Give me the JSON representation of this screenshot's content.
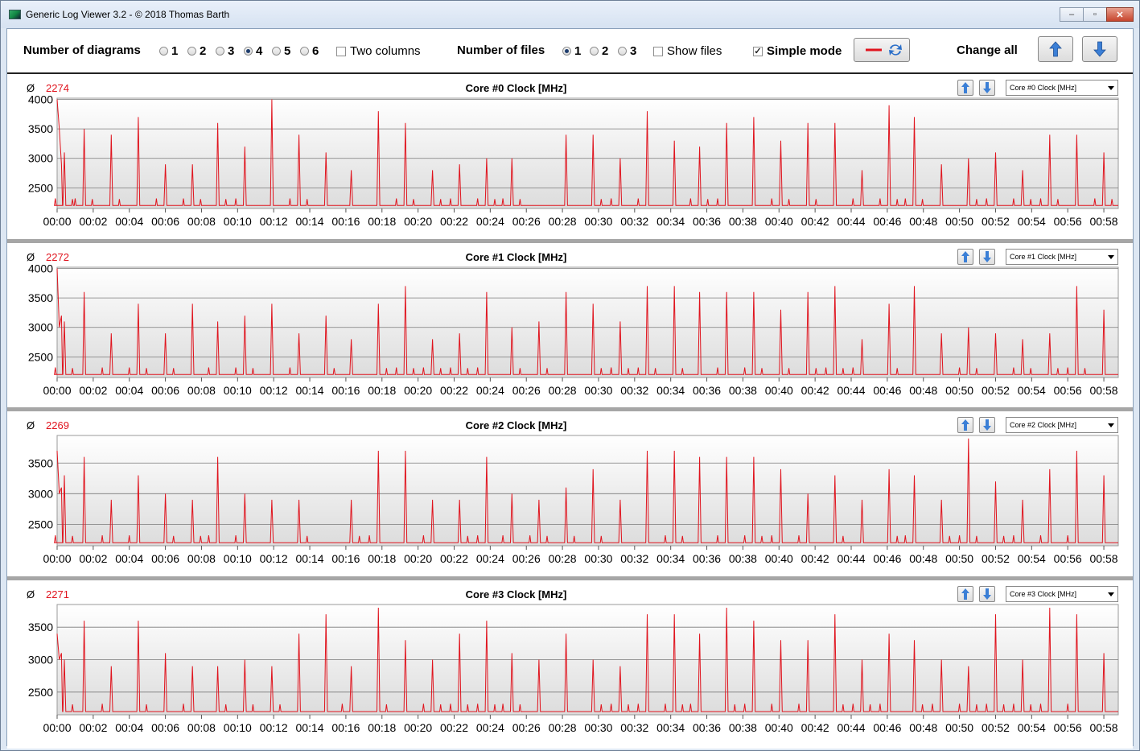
{
  "window": {
    "title": "Generic Log Viewer 3.2 - © 2018 Thomas Barth",
    "minimize": "–",
    "maximize": "▫",
    "close": "✕"
  },
  "toolbar": {
    "diagrams_label": "Number of diagrams",
    "diagram_options": [
      "1",
      "2",
      "3",
      "4",
      "5",
      "6"
    ],
    "diagram_selected": "4",
    "two_columns_label": "Two columns",
    "two_columns_checked": false,
    "files_label": "Number of files",
    "file_options": [
      "1",
      "2",
      "3"
    ],
    "file_selected": "1",
    "show_files_label": "Show files",
    "show_files_checked": false,
    "simple_mode_label": "Simple mode",
    "simple_mode_checked": true,
    "change_all_label": "Change all",
    "line_color": "#e0141e",
    "refresh_color": "#2a6fc9",
    "arrow_color": "#3b7fd6"
  },
  "x_ticks": [
    "00:00",
    "00:02",
    "00:04",
    "00:06",
    "00:08",
    "00:10",
    "00:12",
    "00:14",
    "00:16",
    "00:18",
    "00:20",
    "00:22",
    "00:24",
    "00:26",
    "00:28",
    "00:30",
    "00:32",
    "00:34",
    "00:36",
    "00:38",
    "00:40",
    "00:42",
    "00:44",
    "00:46",
    "00:48",
    "00:50",
    "00:52",
    "00:54",
    "00:56",
    "00:58"
  ],
  "panels": [
    {
      "avg_symbol": "Ø",
      "avg": "2274",
      "title": "Core #0 Clock [MHz]",
      "select": "Core #0 Clock [MHz]"
    },
    {
      "avg_symbol": "Ø",
      "avg": "2272",
      "title": "Core #1 Clock [MHz]",
      "select": "Core #1 Clock [MHz]"
    },
    {
      "avg_symbol": "Ø",
      "avg": "2269",
      "title": "Core #2 Clock [MHz]",
      "select": "Core #2 Clock [MHz]"
    },
    {
      "avg_symbol": "Ø",
      "avg": "2271",
      "title": "Core #3 Clock [MHz]",
      "select": "Core #3 Clock [MHz]"
    }
  ],
  "chart_data": [
    {
      "type": "line",
      "title": "Core #0 Clock [MHz]",
      "xlabel": "",
      "ylabel": "",
      "yticks": [
        2500,
        3000,
        3500,
        4000
      ],
      "ylim": [
        2150,
        4020
      ],
      "xlim_minutes": [
        0,
        58.8
      ],
      "baseline": 2200,
      "series": [
        {
          "values_note_free": true,
          "color": "#e0141e",
          "start": [
            4000,
            3500,
            2900
          ],
          "spikes": [
            [
              0.4,
              3100
            ],
            [
              1.5,
              3500
            ],
            [
              3.0,
              3400
            ],
            [
              4.5,
              3700
            ],
            [
              6.0,
              2900
            ],
            [
              7.5,
              2900
            ],
            [
              8.9,
              3600
            ],
            [
              10.4,
              3200
            ],
            [
              11.9,
              4000
            ],
            [
              13.4,
              3400
            ],
            [
              14.9,
              3100
            ],
            [
              16.3,
              2800
            ],
            [
              17.8,
              3800
            ],
            [
              19.3,
              3600
            ],
            [
              20.8,
              2800
            ],
            [
              22.3,
              2900
            ],
            [
              23.8,
              3000
            ],
            [
              25.2,
              3000
            ],
            [
              28.2,
              3400
            ],
            [
              29.7,
              3400
            ],
            [
              31.2,
              3000
            ],
            [
              32.7,
              3800
            ],
            [
              34.2,
              3300
            ],
            [
              35.6,
              3200
            ],
            [
              37.1,
              3600
            ],
            [
              38.6,
              3700
            ],
            [
              40.1,
              3300
            ],
            [
              41.6,
              3600
            ],
            [
              43.1,
              3600
            ],
            [
              44.6,
              2800
            ],
            [
              46.1,
              3900
            ],
            [
              47.5,
              3700
            ],
            [
              49.0,
              2900
            ],
            [
              50.5,
              3000
            ],
            [
              52.0,
              3100
            ],
            [
              53.5,
              2800
            ],
            [
              55.0,
              3400
            ],
            [
              56.5,
              3400
            ],
            [
              58.0,
              3100
            ]
          ]
        }
      ]
    },
    {
      "type": "line",
      "title": "Core #1 Clock [MHz]",
      "xlabel": "",
      "ylabel": "",
      "yticks": [
        2500,
        3000,
        3500,
        4000
      ],
      "ylim": [
        2150,
        4020
      ],
      "xlim_minutes": [
        0,
        58.8
      ],
      "baseline": 2200,
      "series": [
        {
          "color": "#e0141e",
          "start": [
            4000,
            3000,
            3200
          ],
          "spikes": [
            [
              0.4,
              3100
            ],
            [
              1.5,
              3600
            ],
            [
              3.0,
              2900
            ],
            [
              4.5,
              3400
            ],
            [
              6.0,
              2900
            ],
            [
              7.5,
              3400
            ],
            [
              8.9,
              3100
            ],
            [
              10.4,
              3200
            ],
            [
              11.9,
              3400
            ],
            [
              13.4,
              2900
            ],
            [
              14.9,
              3200
            ],
            [
              16.3,
              2800
            ],
            [
              17.8,
              3400
            ],
            [
              19.3,
              3700
            ],
            [
              20.8,
              2800
            ],
            [
              22.3,
              2900
            ],
            [
              23.8,
              3600
            ],
            [
              25.2,
              3000
            ],
            [
              26.7,
              3100
            ],
            [
              28.2,
              3600
            ],
            [
              29.7,
              3400
            ],
            [
              31.2,
              3100
            ],
            [
              32.7,
              3700
            ],
            [
              34.2,
              3700
            ],
            [
              35.6,
              3600
            ],
            [
              37.1,
              3600
            ],
            [
              38.6,
              3600
            ],
            [
              40.1,
              3300
            ],
            [
              41.6,
              3600
            ],
            [
              43.1,
              3700
            ],
            [
              44.6,
              2800
            ],
            [
              46.1,
              3400
            ],
            [
              47.5,
              3700
            ],
            [
              49.0,
              2900
            ],
            [
              50.5,
              3000
            ],
            [
              52.0,
              2900
            ],
            [
              53.5,
              2800
            ],
            [
              55.0,
              2900
            ],
            [
              56.5,
              3700
            ],
            [
              58.0,
              3300
            ]
          ]
        }
      ]
    },
    {
      "type": "line",
      "title": "Core #2 Clock [MHz]",
      "xlabel": "",
      "ylabel": "",
      "yticks": [
        2500,
        3000,
        3500
      ],
      "ylim": [
        2150,
        3950
      ],
      "xlim_minutes": [
        0,
        58.8
      ],
      "baseline": 2200,
      "series": [
        {
          "color": "#e0141e",
          "start": [
            3700,
            3000,
            3100
          ],
          "spikes": [
            [
              0.4,
              3300
            ],
            [
              1.5,
              3600
            ],
            [
              3.0,
              2900
            ],
            [
              4.5,
              3300
            ],
            [
              6.0,
              3000
            ],
            [
              7.5,
              2900
            ],
            [
              8.9,
              3600
            ],
            [
              10.4,
              3000
            ],
            [
              11.9,
              2900
            ],
            [
              13.4,
              2900
            ],
            [
              16.3,
              2900
            ],
            [
              17.8,
              3700
            ],
            [
              19.3,
              3700
            ],
            [
              20.8,
              2900
            ],
            [
              22.3,
              2900
            ],
            [
              23.8,
              3600
            ],
            [
              25.2,
              3000
            ],
            [
              26.7,
              2900
            ],
            [
              28.2,
              3100
            ],
            [
              29.7,
              3400
            ],
            [
              31.2,
              2900
            ],
            [
              32.7,
              3700
            ],
            [
              34.2,
              3700
            ],
            [
              35.6,
              3600
            ],
            [
              37.1,
              3600
            ],
            [
              38.6,
              3600
            ],
            [
              40.1,
              3400
            ],
            [
              41.6,
              3000
            ],
            [
              43.1,
              3300
            ],
            [
              44.6,
              2900
            ],
            [
              46.1,
              3400
            ],
            [
              47.5,
              3300
            ],
            [
              49.0,
              2900
            ],
            [
              50.5,
              3900
            ],
            [
              52.0,
              3200
            ],
            [
              53.5,
              2900
            ],
            [
              55.0,
              3400
            ],
            [
              56.5,
              3700
            ],
            [
              58.0,
              3300
            ]
          ]
        }
      ]
    },
    {
      "type": "line",
      "title": "Core #3 Clock [MHz]",
      "xlabel": "",
      "ylabel": "",
      "yticks": [
        2500,
        3000,
        3500
      ],
      "ylim": [
        2150,
        3850
      ],
      "xlim_minutes": [
        0,
        58.8
      ],
      "baseline": 2200,
      "series": [
        {
          "color": "#e0141e",
          "start": [
            3400,
            3000,
            3100
          ],
          "spikes": [
            [
              0.4,
              3000
            ],
            [
              1.5,
              3600
            ],
            [
              3.0,
              2900
            ],
            [
              4.5,
              3600
            ],
            [
              6.0,
              3100
            ],
            [
              7.5,
              2900
            ],
            [
              8.9,
              2900
            ],
            [
              10.4,
              3000
            ],
            [
              11.9,
              2900
            ],
            [
              13.4,
              3400
            ],
            [
              14.9,
              3700
            ],
            [
              16.3,
              2900
            ],
            [
              17.8,
              3800
            ],
            [
              19.3,
              3300
            ],
            [
              20.8,
              3000
            ],
            [
              22.3,
              3400
            ],
            [
              23.8,
              3600
            ],
            [
              25.2,
              3100
            ],
            [
              26.7,
              3000
            ],
            [
              28.2,
              3400
            ],
            [
              29.7,
              3000
            ],
            [
              31.2,
              2900
            ],
            [
              32.7,
              3700
            ],
            [
              34.2,
              3700
            ],
            [
              35.6,
              3400
            ],
            [
              37.1,
              3800
            ],
            [
              38.6,
              3600
            ],
            [
              40.1,
              3300
            ],
            [
              41.6,
              3300
            ],
            [
              43.1,
              3700
            ],
            [
              44.6,
              3000
            ],
            [
              46.1,
              3400
            ],
            [
              47.5,
              3300
            ],
            [
              49.0,
              3000
            ],
            [
              50.5,
              2900
            ],
            [
              52.0,
              3700
            ],
            [
              53.5,
              3000
            ],
            [
              55.0,
              3800
            ],
            [
              56.5,
              3700
            ],
            [
              58.0,
              3100
            ]
          ]
        }
      ]
    }
  ]
}
